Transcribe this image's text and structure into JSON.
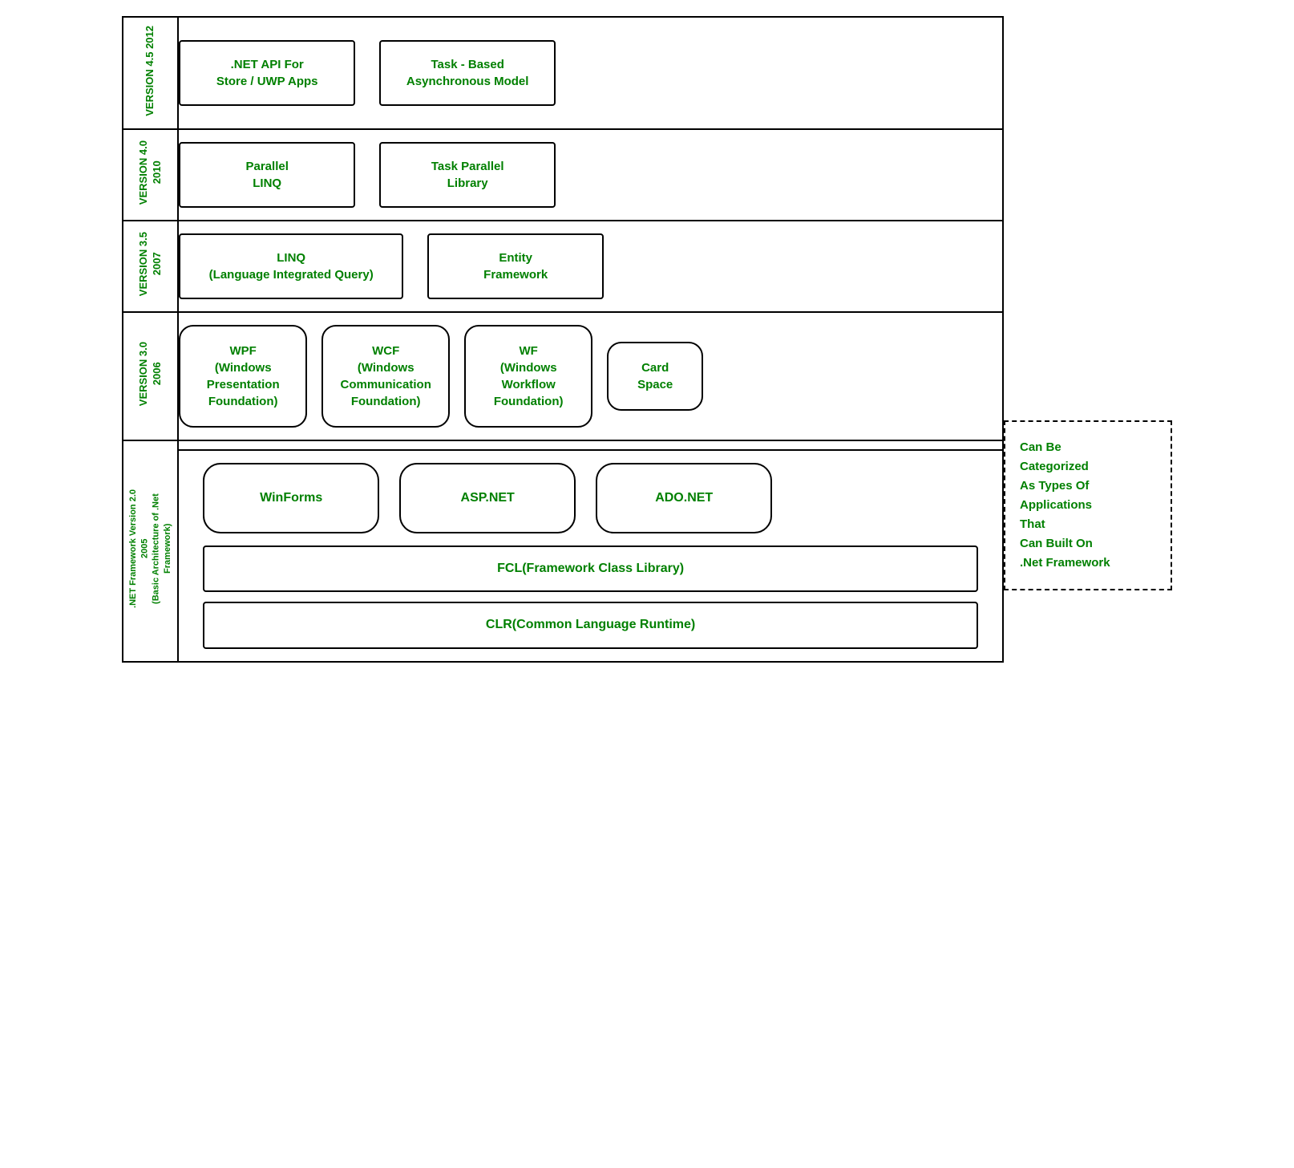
{
  "versions": [
    {
      "id": "v45",
      "label": "VERSION 4.5\n2012",
      "boxes": [
        {
          "text": ".NET API For\nStore / UWP Apps",
          "type": "rect"
        },
        {
          "text": "Task - Based\nAsynchronous Model",
          "type": "rect"
        }
      ]
    },
    {
      "id": "v40",
      "label": "VERSION 4.0\n2010",
      "boxes": [
        {
          "text": "Parallel\nLINQ",
          "type": "rect"
        },
        {
          "text": "Task Parallel\nLibrary",
          "type": "rect"
        }
      ]
    },
    {
      "id": "v35",
      "label": "VERSION 3.5\n2007",
      "boxes": [
        {
          "text": "LINQ\n(Language Integrated Query)",
          "type": "rect"
        },
        {
          "text": "Entity\nFramework",
          "type": "rect"
        }
      ]
    },
    {
      "id": "v30",
      "label": "VERSION 3.0\n2006",
      "boxes": [
        {
          "text": "WPF\n(Windows\nPresentation\nFoundation)",
          "type": "rounded"
        },
        {
          "text": "WCF\n(Windows\nCommunication\nFoundation)",
          "type": "rounded"
        },
        {
          "text": "WF\n(Windows\nWorkflow\nFoundation)",
          "type": "rounded"
        },
        {
          "text": "Card\nSpace",
          "type": "rounded"
        }
      ]
    }
  ],
  "bottom": {
    "version_label": ".NET Framework Version 2.0\n2005\n(Basic Architecture of .Net\nFramework)",
    "apps": [
      {
        "text": "WinForms",
        "type": "rounded-large"
      },
      {
        "text": "ASP.NET",
        "type": "rounded-large"
      },
      {
        "text": "ADO.NET",
        "type": "rounded-large"
      }
    ],
    "fcl": "FCL(Framework Class Library)",
    "clr": "CLR(Common Language Runtime)",
    "arrow_label": "Can Be\nCategorized\nAs Types Of\nApplications\nThat\nCan Built On\n.Net Framework"
  }
}
